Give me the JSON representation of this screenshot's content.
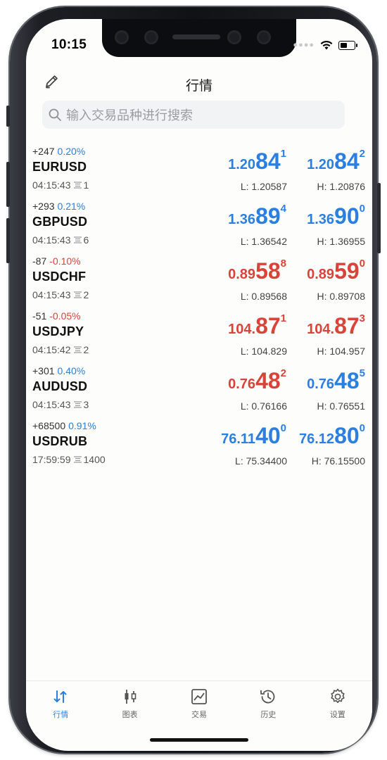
{
  "status": {
    "time": "10:15"
  },
  "header": {
    "title": "行情",
    "search_placeholder": "输入交易品种进行搜索"
  },
  "colors": {
    "up": "#2b7fe0",
    "down": "#d9443a",
    "accent": "#2b7fe0"
  },
  "quotes": [
    {
      "change": "+247",
      "pct": "0.20%",
      "symbol": "EURUSD",
      "time": "04:15:43",
      "spread": "1",
      "dir": "up",
      "bid": {
        "pre": "1.20",
        "big": "84",
        "sup": "1",
        "color": "blue"
      },
      "ask": {
        "pre": "1.20",
        "big": "84",
        "sup": "2",
        "color": "blue"
      },
      "low": "L: 1.20587",
      "high": "H: 1.20876"
    },
    {
      "change": "+293",
      "pct": "0.21%",
      "symbol": "GBPUSD",
      "time": "04:15:43",
      "spread": "6",
      "dir": "up",
      "bid": {
        "pre": "1.36",
        "big": "89",
        "sup": "4",
        "color": "blue"
      },
      "ask": {
        "pre": "1.36",
        "big": "90",
        "sup": "0",
        "color": "blue"
      },
      "low": "L: 1.36542",
      "high": "H: 1.36955"
    },
    {
      "change": "-87",
      "pct": "-0.10%",
      "symbol": "USDCHF",
      "time": "04:15:43",
      "spread": "2",
      "dir": "down",
      "bid": {
        "pre": "0.89",
        "big": "58",
        "sup": "8",
        "color": "red"
      },
      "ask": {
        "pre": "0.89",
        "big": "59",
        "sup": "0",
        "color": "red"
      },
      "low": "L: 0.89568",
      "high": "H: 0.89708"
    },
    {
      "change": "-51",
      "pct": "-0.05%",
      "symbol": "USDJPY",
      "time": "04:15:42",
      "spread": "2",
      "dir": "down",
      "bid": {
        "pre": "104.",
        "big": "87",
        "sup": "1",
        "color": "red"
      },
      "ask": {
        "pre": "104.",
        "big": "87",
        "sup": "3",
        "color": "red"
      },
      "low": "L: 104.829",
      "high": "H: 104.957"
    },
    {
      "change": "+301",
      "pct": "0.40%",
      "symbol": "AUDUSD",
      "time": "04:15:43",
      "spread": "3",
      "dir": "up",
      "bid": {
        "pre": "0.76",
        "big": "48",
        "sup": "2",
        "color": "red"
      },
      "ask": {
        "pre": "0.76",
        "big": "48",
        "sup": "5",
        "color": "blue"
      },
      "low": "L: 0.76166",
      "high": "H: 0.76551"
    },
    {
      "change": "+68500",
      "pct": "0.91%",
      "symbol": "USDRUB",
      "time": "17:59:59",
      "spread": "1400",
      "dir": "up",
      "bid": {
        "pre": "76.11",
        "big": "40",
        "sup": "0",
        "color": "blue"
      },
      "ask": {
        "pre": "76.12",
        "big": "80",
        "sup": "0",
        "color": "blue"
      },
      "low": "L: 75.34400",
      "high": "H: 76.15500"
    }
  ],
  "tabs": [
    {
      "label": "行情",
      "icon": "quotes-arrows-icon",
      "active": true
    },
    {
      "label": "图表",
      "icon": "candlestick-chart-icon",
      "active": false
    },
    {
      "label": "交易",
      "icon": "trade-chart-icon",
      "active": false
    },
    {
      "label": "历史",
      "icon": "history-clock-icon",
      "active": false
    },
    {
      "label": "设置",
      "icon": "settings-gear-icon",
      "active": false
    }
  ]
}
